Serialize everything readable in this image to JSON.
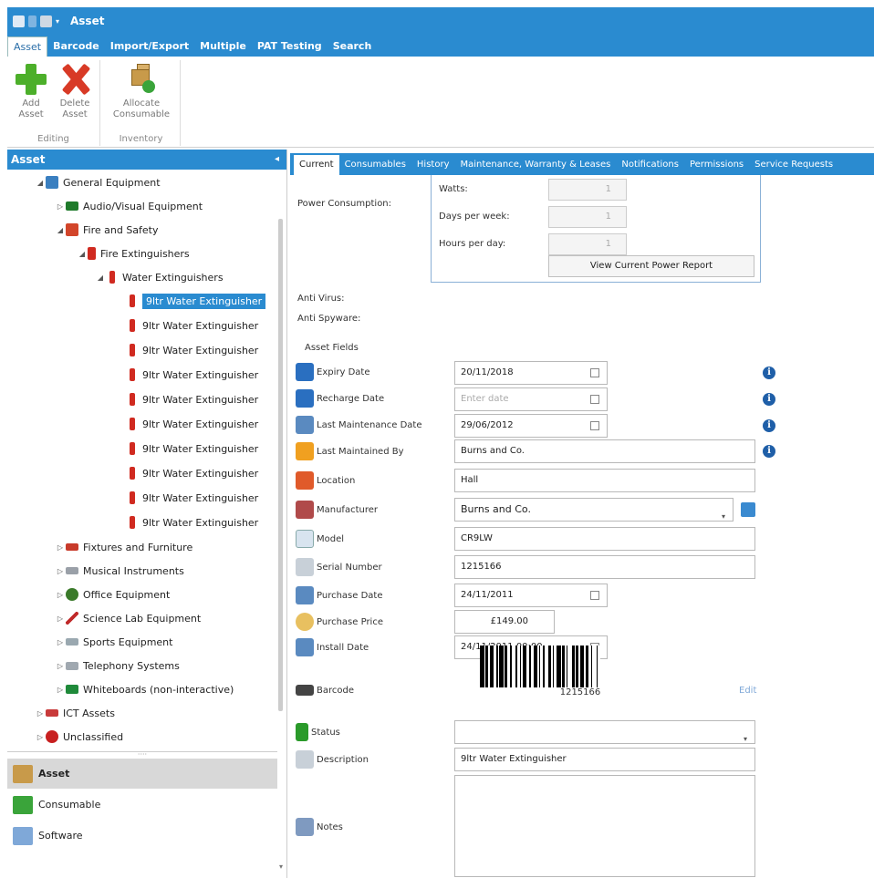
{
  "window": {
    "title": "Asset"
  },
  "menu": {
    "tabs": [
      "Asset",
      "Barcode",
      "Import/Export",
      "Multiple",
      "PAT Testing",
      "Search"
    ]
  },
  "ribbon": {
    "groups": [
      {
        "label": "Editing",
        "buttons": [
          {
            "label1": "Add",
            "label2": "Asset"
          },
          {
            "label1": "Delete",
            "label2": "Asset"
          }
        ]
      },
      {
        "label": "Inventory",
        "buttons": [
          {
            "label1": "Allocate",
            "label2": "Consumable"
          }
        ]
      }
    ]
  },
  "left_panel": {
    "header": "Asset",
    "tree": [
      {
        "label": "General Equipment",
        "expander": "◢"
      },
      {
        "label": "Audio/Visual Equipment",
        "expander": "▷"
      },
      {
        "label": "Fire and Safety",
        "expander": "◢"
      },
      {
        "label": "Fire Extinguishers",
        "expander": "◢"
      },
      {
        "label": "Water Extinguishers",
        "expander": "◢"
      },
      {
        "label": "9ltr Water Extinguisher"
      },
      {
        "label": "9ltr Water Extinguisher"
      },
      {
        "label": "9ltr Water Extinguisher"
      },
      {
        "label": "9ltr Water Extinguisher"
      },
      {
        "label": "9ltr Water Extinguisher"
      },
      {
        "label": "9ltr Water Extinguisher"
      },
      {
        "label": "9ltr Water Extinguisher"
      },
      {
        "label": "9ltr Water Extinguisher"
      },
      {
        "label": "9ltr Water Extinguisher"
      },
      {
        "label": "9ltr Water Extinguisher"
      },
      {
        "label": "Fixtures and Furniture",
        "expander": "▷"
      },
      {
        "label": "Musical Instruments",
        "expander": "▷"
      },
      {
        "label": "Office Equipment",
        "expander": "▷"
      },
      {
        "label": "Science Lab Equipment",
        "expander": "▷"
      },
      {
        "label": "Sports Equipment",
        "expander": "▷"
      },
      {
        "label": "Telephony Systems",
        "expander": "▷"
      },
      {
        "label": "Whiteboards (non-interactive)",
        "expander": "▷"
      },
      {
        "label": "ICT Assets",
        "expander": "▷"
      },
      {
        "label": "Unclassified",
        "expander": "▷"
      }
    ],
    "nav": [
      {
        "label": "Asset"
      },
      {
        "label": "Consumable"
      },
      {
        "label": "Software"
      }
    ]
  },
  "detail_tabs": [
    "Current",
    "Consumables",
    "History",
    "Maintenance, Warranty & Leases",
    "Notifications",
    "Permissions",
    "Service Requests"
  ],
  "power": {
    "label": "Power Consumption:",
    "watts_label": "Watts:",
    "watts": "1",
    "days_label": "Days per week:",
    "days": "1",
    "hours_label": "Hours per day:",
    "hours": "1",
    "report_button": "View Current Power Report"
  },
  "anti_virus": "Anti Virus:",
  "anti_spyware": "Anti Spyware:",
  "asset_fields_label": "Asset Fields",
  "fields": {
    "expiry_date": {
      "label": "Expiry Date",
      "value": "20/11/2018"
    },
    "recharge_date": {
      "label": "Recharge Date",
      "placeholder": "Enter date"
    },
    "last_maintenance_date": {
      "label": "Last Maintenance Date",
      "value": "29/06/2012"
    },
    "last_maintained_by": {
      "label": "Last Maintained By",
      "value": "Burns and Co."
    },
    "location": {
      "label": "Location",
      "value": "Hall"
    },
    "manufacturer": {
      "label": "Manufacturer",
      "value": "Burns and Co."
    },
    "model": {
      "label": "Model",
      "value": "CR9LW"
    },
    "serial_number": {
      "label": "Serial Number",
      "value": "1215166"
    },
    "purchase_date": {
      "label": "Purchase Date",
      "value": "24/11/2011"
    },
    "purchase_price": {
      "label": "Purchase Price",
      "value": "£149.00"
    },
    "install_date": {
      "label": "Install Date",
      "value": "24/11/2011 00:00"
    },
    "barcode": {
      "label": "Barcode",
      "value": "1215166",
      "edit": "Edit"
    },
    "status": {
      "label": "Status",
      "value": ""
    },
    "description": {
      "label": "Description",
      "value": "9ltr Water Extinguisher"
    },
    "notes": {
      "label": "Notes",
      "value": ""
    }
  }
}
